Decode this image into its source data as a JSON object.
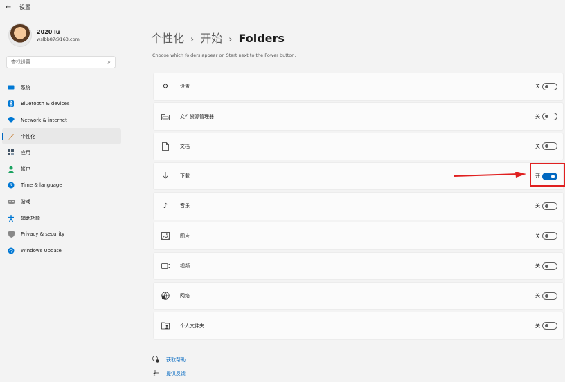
{
  "titlebar": {
    "back_icon": "arrow-left-icon",
    "title": "设置"
  },
  "profile": {
    "name": "2020 lu",
    "email": "wslbb87@163.com"
  },
  "search": {
    "placeholder": "查找设置",
    "icon": "search-icon"
  },
  "nav": {
    "active_index": 3,
    "items": [
      {
        "label": "系统",
        "icon": "monitor-icon",
        "color": "#0078d4"
      },
      {
        "label": "Bluetooth & devices",
        "icon": "bluetooth-icon",
        "color": "#0078d4"
      },
      {
        "label": "Network & internet",
        "icon": "wifi-icon",
        "color": "#0078d4"
      },
      {
        "label": "个性化",
        "icon": "brush-icon",
        "color": "#c47a2c"
      },
      {
        "label": "应用",
        "icon": "apps-icon",
        "color": "#445566"
      },
      {
        "label": "帐户",
        "icon": "person-icon",
        "color": "#1aa260"
      },
      {
        "label": "Time & language",
        "icon": "globe-clock-icon",
        "color": "#0078d4"
      },
      {
        "label": "游戏",
        "icon": "gamepad-icon",
        "color": "#777777"
      },
      {
        "label": "辅助功能",
        "icon": "accessibility-icon",
        "color": "#0078d4"
      },
      {
        "label": "Privacy & security",
        "icon": "shield-icon",
        "color": "#777777"
      },
      {
        "label": "Windows Update",
        "icon": "update-icon",
        "color": "#0078d4"
      }
    ]
  },
  "breadcrumb": {
    "items": [
      "个性化",
      "开始"
    ],
    "current": "Folders",
    "separator": "›"
  },
  "subtitle": "Choose which folders appear on Start next to the Power button.",
  "folders": [
    {
      "label": "设置",
      "icon": "gear-icon",
      "state": "关",
      "on": false
    },
    {
      "label": "文件资源管理器",
      "icon": "file-explorer-icon",
      "state": "关",
      "on": false
    },
    {
      "label": "文档",
      "icon": "document-icon",
      "state": "关",
      "on": false
    },
    {
      "label": "下载",
      "icon": "download-icon",
      "state": "开",
      "on": true
    },
    {
      "label": "音乐",
      "icon": "music-icon",
      "state": "关",
      "on": false
    },
    {
      "label": "图片",
      "icon": "picture-icon",
      "state": "关",
      "on": false
    },
    {
      "label": "视频",
      "icon": "video-icon",
      "state": "关",
      "on": false
    },
    {
      "label": "网络",
      "icon": "network-icon",
      "state": "关",
      "on": false
    },
    {
      "label": "个人文件夹",
      "icon": "personal-folder-icon",
      "state": "关",
      "on": false
    }
  ],
  "help": [
    {
      "label": "获取帮助",
      "icon": "help-icon"
    },
    {
      "label": "提供反馈",
      "icon": "feedback-icon"
    }
  ],
  "colors": {
    "accent": "#0067c0",
    "annotation": "#e02020"
  }
}
